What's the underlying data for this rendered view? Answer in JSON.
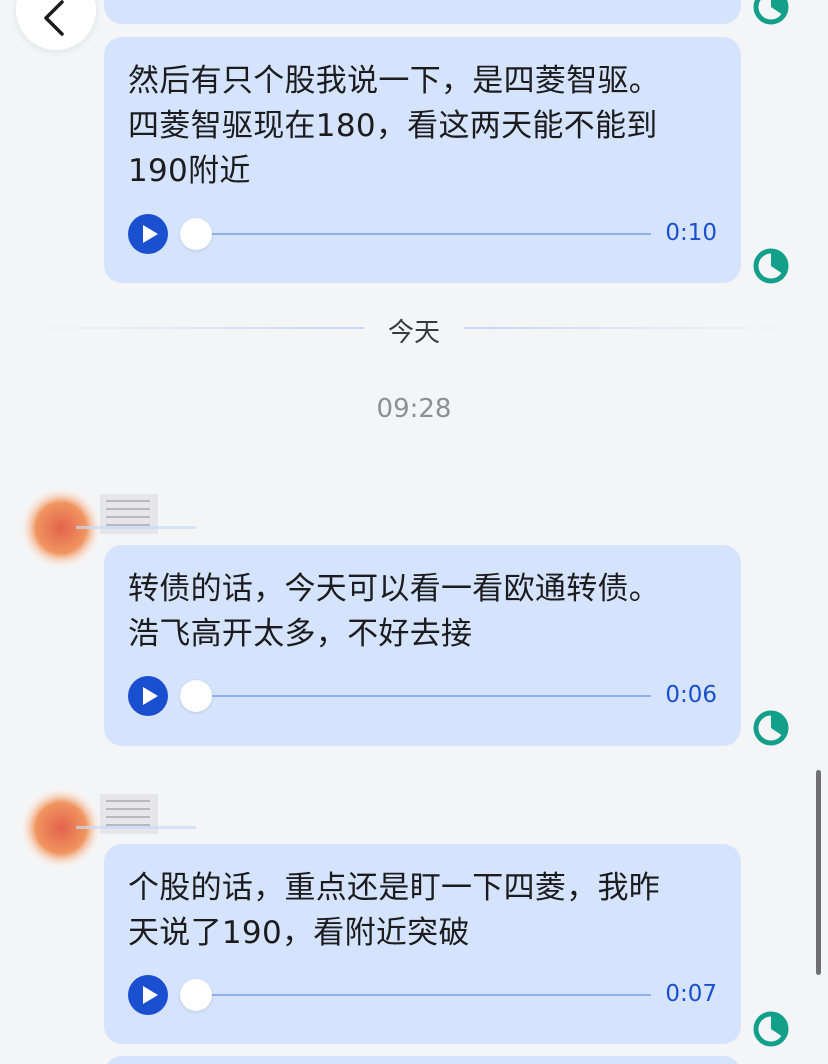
{
  "messages": [
    {
      "text_lines": [
        "然后有只个股我说一下，是四菱智驱。",
        "四菱智驱现在180，看这两天能不能到",
        "190附近"
      ],
      "duration": "0:10"
    },
    {
      "text_lines": [
        "转债的话，今天可以看一看欧通转债。",
        "浩飞高开太多，不好去接"
      ],
      "duration": "0:06"
    },
    {
      "text_lines": [
        "个股的话，重点还是盯一下四菱，我昨",
        "天说了190，看附近突破"
      ],
      "duration": "0:07"
    }
  ],
  "date_divider": "今天",
  "timestamp": "09:28",
  "colors": {
    "bubble": "#d5e3fd",
    "accent_blue": "#1a4fd0",
    "status_green": "#13a08a",
    "background": "#f4f5f7"
  },
  "icons": {
    "back": "chevron-left-icon",
    "play": "play-icon",
    "status": "clock-status-icon"
  }
}
